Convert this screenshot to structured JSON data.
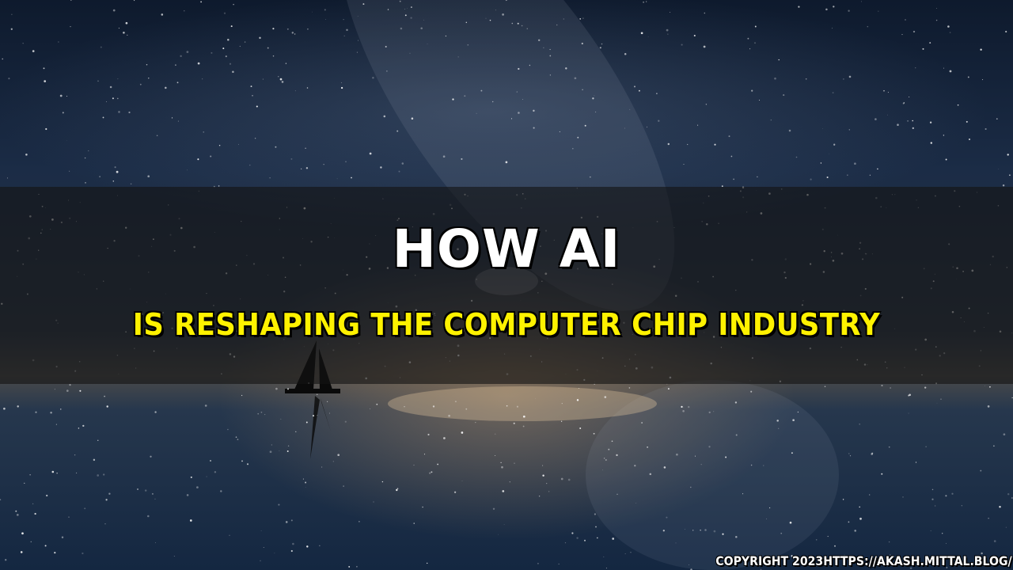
{
  "title": "HOW AI",
  "subtitle": "IS RESHAPING THE COMPUTER CHIP INDUSTRY",
  "copyright": "COPYRIGHT 2023HTTPS://AKASH.MITTAL.BLOG/",
  "colors": {
    "title": "#ffffff",
    "subtitle": "#fff200",
    "band": "#141414"
  },
  "scene": {
    "background": "night sky with milky way over calm sea",
    "boat": "sailboat silhouette"
  }
}
